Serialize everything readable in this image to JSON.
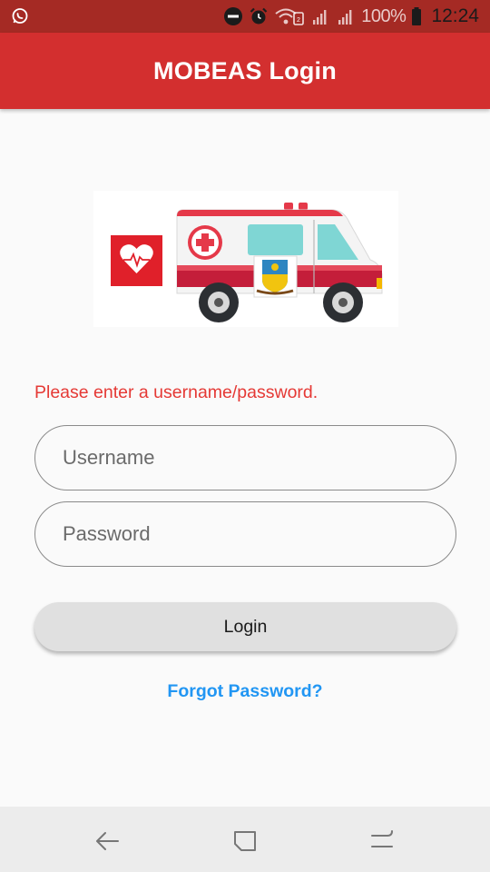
{
  "status_bar": {
    "battery_percent": "100%",
    "time": "12:24",
    "icons": [
      "whatsapp-icon",
      "do-not-disturb-icon",
      "alarm-icon",
      "wifi-icon",
      "signal-icon",
      "signal-icon",
      "battery-icon"
    ]
  },
  "app_bar": {
    "title": "MOBEAS Login"
  },
  "colors": {
    "app_bar": "#d32f2f",
    "status_bar": "#a52a24",
    "error": "#e53935",
    "link": "#2196f3"
  },
  "form": {
    "error_message": "Please enter a username/password.",
    "username_placeholder": "Username",
    "username_value": "",
    "password_placeholder": "Password",
    "password_value": "",
    "login_label": "Login",
    "forgot_label": "Forgot Password?"
  },
  "nav_bar": {
    "buttons": [
      "back-icon",
      "recent-apps-icon",
      "home-icon"
    ]
  }
}
